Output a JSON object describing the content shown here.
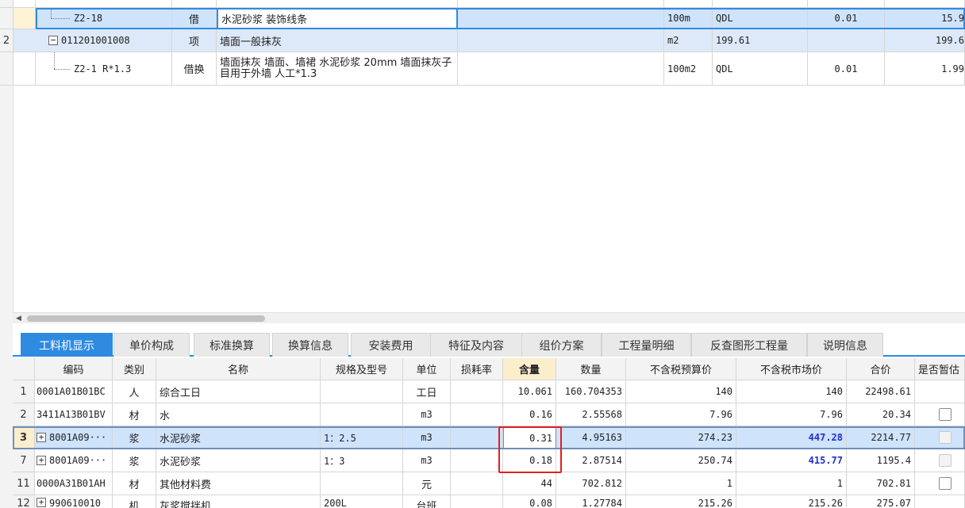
{
  "top_grid": {
    "rows": [
      {
        "num": "",
        "code": "Z2-18",
        "type": "借",
        "name": "水泥砂浆 装饰线条",
        "unit": "100m",
        "qty_expr": "QDL",
        "content": "0.01",
        "qty": "15.9",
        "selected": true
      },
      {
        "num": "2",
        "code": "011201001008",
        "type": "项",
        "name": "墙面一般抹灰",
        "unit": "m2",
        "qty_expr": "199.61",
        "content": "",
        "qty": "199.6",
        "expand": "−"
      },
      {
        "num": "",
        "code": "Z2-1 R*1.3",
        "type": "借换",
        "name": "墙面抹灰 墙面、墙裙 水泥砂浆 20mm 墙面抹灰子目用于外墙 人工*1.3",
        "unit": "100m2",
        "qty_expr": "QDL",
        "content": "0.01",
        "qty": "1.99"
      }
    ]
  },
  "scrollbar": {
    "left_arrow": "◀"
  },
  "tabs": [
    {
      "label": "工料机显示",
      "active": true
    },
    {
      "label": "单价构成"
    },
    {
      "label": "标准换算"
    },
    {
      "label": "换算信息"
    },
    {
      "label": "安装费用"
    },
    {
      "label": "特征及内容"
    },
    {
      "label": "组价方案"
    },
    {
      "label": "工程量明细"
    },
    {
      "label": "反查图形工程量"
    },
    {
      "label": "说明信息"
    }
  ],
  "bottom_grid": {
    "headers": [
      "编码",
      "类别",
      "名称",
      "规格及型号",
      "单位",
      "损耗率",
      "含量",
      "数量",
      "不含税预算价",
      "不含税市场价",
      "合价",
      "是否暂估"
    ],
    "rows": [
      {
        "num": "1",
        "code": "0001A01B01BC",
        "cat": "人",
        "name": "综合工日",
        "spec": "",
        "unit": "工日",
        "loss": "",
        "content": "10.061",
        "qty": "160.704353",
        "budget": "140",
        "market": "140",
        "total": "22498.61",
        "check": "none"
      },
      {
        "num": "2",
        "code": "3411A13B01BV",
        "cat": "材",
        "name": "水",
        "spec": "",
        "unit": "m3",
        "loss": "",
        "content": "0.16",
        "qty": "2.55568",
        "budget": "7.96",
        "market": "7.96",
        "total": "20.34",
        "check": "box"
      },
      {
        "num": "3",
        "code": "8001A09···",
        "cat": "浆",
        "name": "水泥砂浆",
        "spec": "1：2.5",
        "unit": "m3",
        "loss": "",
        "content": "0.31",
        "qty": "4.95163",
        "budget": "274.23",
        "market": "447.28",
        "total": "2214.77",
        "check": "disabled",
        "expand": "+",
        "selected": true,
        "market_highlight": true
      },
      {
        "num": "7",
        "code": "8001A09···",
        "cat": "浆",
        "name": "水泥砂浆",
        "spec": "1：3",
        "unit": "m3",
        "loss": "",
        "content": "0.18",
        "qty": "2.87514",
        "budget": "250.74",
        "market": "415.77",
        "total": "1195.4",
        "check": "disabled",
        "expand": "+",
        "market_highlight": true
      },
      {
        "num": "11",
        "code": "0000A31B01AH",
        "cat": "材",
        "name": "其他材料费",
        "spec": "",
        "unit": "元",
        "loss": "",
        "content": "44",
        "qty": "702.812",
        "budget": "1",
        "market": "1",
        "total": "702.81",
        "check": "box"
      },
      {
        "num": "12",
        "code": "990610010",
        "cat": "机",
        "name": "灰浆搅拌机",
        "spec": "200L",
        "unit": "台班",
        "loss": "",
        "content": "0.08",
        "qty": "1.27784",
        "budget": "215.26",
        "market": "215.26",
        "total": "275.07",
        "check": "none",
        "expand": "+"
      }
    ]
  },
  "colors": {
    "accent": "#2e8be0",
    "selection": "#cfe3fb",
    "annotation": "#e02020",
    "highlight_text": "#1f2fd6"
  }
}
